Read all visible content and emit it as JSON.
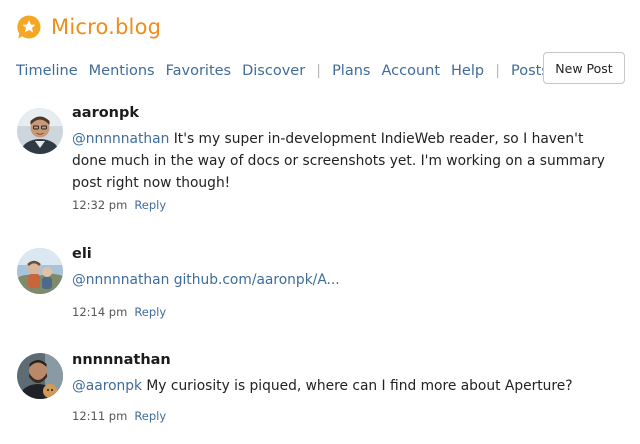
{
  "app": {
    "brand": "Micro.blog",
    "accent_color": "#f08c1a",
    "link_color": "#3f6c9c",
    "logo_icon": "star-speech-bubble-icon"
  },
  "nav": {
    "items": [
      "Timeline",
      "Mentions",
      "Favorites",
      "Discover"
    ],
    "separator": "|",
    "items2": [
      "Plans",
      "Account",
      "Help"
    ],
    "items3": [
      "Posts"
    ],
    "new_post_label": "New Post"
  },
  "posts": [
    {
      "username": "aaronpk",
      "mention": "@nnnnnathan",
      "text": " It's my super in-development IndieWeb reader, so I haven't done much in the way of docs or screenshots yet. I'm working on a summary post right now though!",
      "time": "12:32 pm",
      "reply_label": "Reply",
      "avatar_icon": "avatar-aaronpk"
    },
    {
      "username": "eli",
      "mention": "@nnnnnathan",
      "link": "github.com/aaronpk/A...",
      "time": "12:14 pm",
      "reply_label": "Reply",
      "avatar_icon": "avatar-eli"
    },
    {
      "username": "nnnnnathan",
      "mention": "@aaronpk",
      "text": " My curiosity is piqued, where can I find more about Aperture?",
      "time": "12:11 pm",
      "reply_label": "Reply",
      "avatar_icon": "avatar-nnnnnathan"
    }
  ]
}
